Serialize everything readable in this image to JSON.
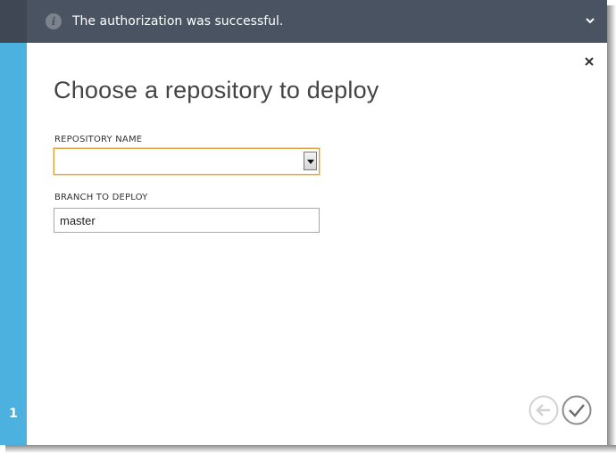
{
  "notification": {
    "message": "The authorization was successful.",
    "info_icon": "info-icon",
    "expand_icon": "chevron-down-icon"
  },
  "wizard": {
    "title": "Choose a repository to deploy",
    "step_number": "1",
    "close_icon": "close-icon",
    "fields": {
      "repository_name_label": "REPOSITORY NAME",
      "repository_name_value": "",
      "branch_label": "BRANCH TO DEPLOY",
      "branch_value": "master"
    },
    "back_icon": "arrow-left-icon",
    "complete_icon": "checkmark-icon"
  },
  "colors": {
    "notification_bg": "#4a5361",
    "rail_accent": "#4db1e0",
    "focus_border": "#e2a23b"
  }
}
